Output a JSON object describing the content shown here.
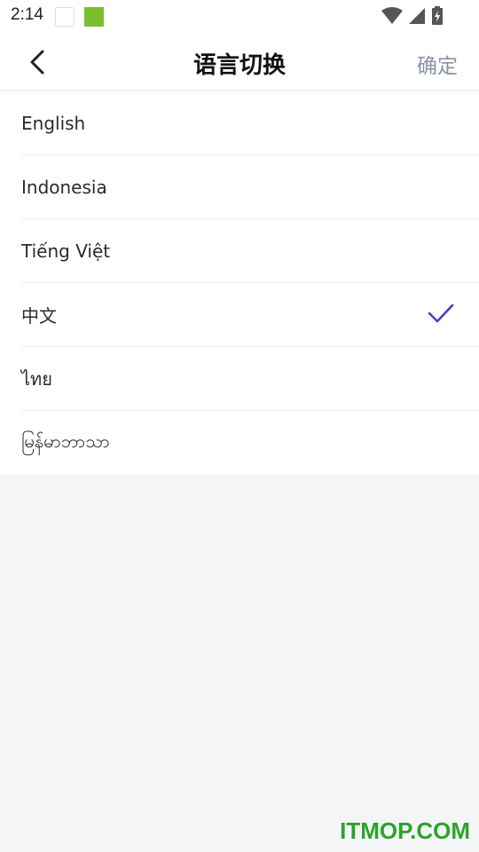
{
  "status_bar": {
    "time": "2:14",
    "icons": [
      "app-icon",
      "app-icon",
      "wifi-icon",
      "signal-icon",
      "battery-icon"
    ]
  },
  "navbar": {
    "title": "语言切换",
    "confirm_label": "确定",
    "back_icon": "chevron-left-icon"
  },
  "languages": [
    {
      "label": "English",
      "selected": false
    },
    {
      "label": "Indonesia",
      "selected": false
    },
    {
      "label": "Tiếng Việt",
      "selected": false
    },
    {
      "label": "中文",
      "selected": true
    },
    {
      "label": "ไทย",
      "selected": false
    },
    {
      "label": "မြန်မာဘာသာ",
      "selected": false
    }
  ],
  "colors": {
    "check": "#4a3fc4",
    "confirm_text": "#8a93a3",
    "background": "#f4f5f7",
    "watermark": "#2aa52a"
  },
  "watermark": "ITMOP.COM"
}
